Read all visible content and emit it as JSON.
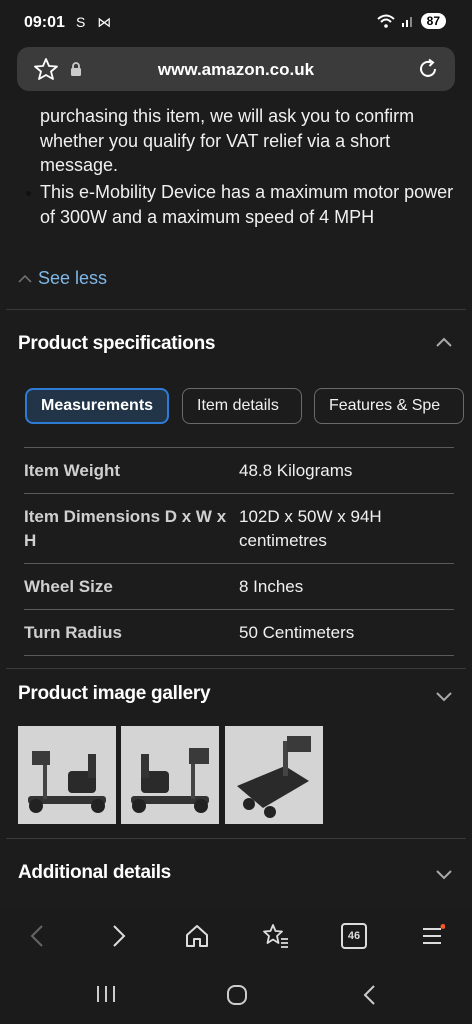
{
  "status": {
    "time": "09:01",
    "left_icons": "S ⋈",
    "battery": "87"
  },
  "browser": {
    "url": "www.amazon.co.uk",
    "tab_count": "46"
  },
  "description": {
    "continued_text": "purchasing this item, we will ask you to confirm whether you qualify for VAT relief via a short message.",
    "bullet_text": "This e-Mobility Device has a maximum motor power of 300W and a maximum speed of 4 MPH",
    "see_less": "See less"
  },
  "specs": {
    "title": "Product specifications",
    "tabs": [
      "Measurements",
      "Item details",
      "Features & Spe"
    ],
    "rows": [
      {
        "key": "Item Weight",
        "value": "48.8 Kilograms"
      },
      {
        "key": "Item Dimensions D x W x H",
        "value": "102D x 50W x 94H centimetres"
      },
      {
        "key": "Wheel Size",
        "value": "8 Inches"
      },
      {
        "key": "Turn Radius",
        "value": "50 Centimeters"
      }
    ]
  },
  "gallery": {
    "title": "Product image gallery"
  },
  "additional": {
    "title": "Additional details"
  },
  "colors": {
    "accent": "#2e7bd6",
    "link": "#7fb8e8",
    "background": "#1c1c1c"
  }
}
